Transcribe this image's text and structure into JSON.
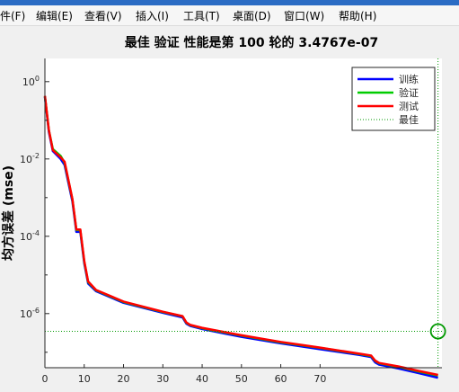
{
  "menubar": {
    "items": [
      {
        "label": "件(F)"
      },
      {
        "label": "编辑(E)"
      },
      {
        "label": "查看(V)"
      },
      {
        "label": "插入(I)"
      },
      {
        "label": "工具(T)"
      },
      {
        "label": "桌面(D)"
      },
      {
        "label": "窗口(W)"
      },
      {
        "label": "帮助(H)"
      }
    ]
  },
  "colors": {
    "train": "#0000ff",
    "validation": "#00cc00",
    "test": "#ff0000",
    "best": "#009900"
  },
  "chart_data": {
    "type": "line",
    "title": "最佳 验证 性能是第 100 轮的 3.4767e-07",
    "ylabel": "均方误差 (mse)",
    "xlabel": "",
    "xlim": [
      0,
      101
    ],
    "ylim_log10": [
      -7.4,
      0.6
    ],
    "y_scale": "log",
    "xticks": [
      0,
      10,
      20,
      30,
      40,
      50,
      60,
      70
    ],
    "xtick_labels": [
      "0",
      "10",
      "20",
      "30",
      "40",
      "50",
      "60",
      "70"
    ],
    "yticks": [
      1e-06,
      0.0001,
      0.01,
      1
    ],
    "ytick_labels": [
      {
        "base": "10",
        "exp": "-6"
      },
      {
        "base": "10",
        "exp": "-4"
      },
      {
        "base": "10",
        "exp": "-2"
      },
      {
        "base": "10",
        "exp": "0"
      }
    ],
    "legend": {
      "position": "top-right",
      "entries": [
        {
          "label": "训练",
          "color": "#0000ff",
          "style": "solid"
        },
        {
          "label": "验证",
          "color": "#00cc00",
          "style": "solid"
        },
        {
          "label": "测试",
          "color": "#ff0000",
          "style": "solid"
        },
        {
          "label": "最佳",
          "color": "#009900",
          "style": "dotted"
        }
      ]
    },
    "series": [
      {
        "name": "训练",
        "color": "#0000ff",
        "x": [
          0,
          1,
          2,
          4,
          5,
          7,
          8,
          9,
          10,
          11,
          13,
          20,
          30,
          35,
          36,
          37,
          40,
          50,
          60,
          70,
          80,
          83,
          84,
          85,
          90,
          95,
          100
        ],
        "y": [
          0.4,
          0.05,
          0.016,
          0.01,
          0.007,
          0.0008,
          0.00013,
          0.00013,
          2e-05,
          6e-06,
          3.8e-06,
          1.9e-06,
          1.05e-06,
          8e-07,
          5.5e-07,
          4.8e-07,
          4e-07,
          2.5e-07,
          1.7e-07,
          1.2e-07,
          8.5e-08,
          7.5e-08,
          5.5e-08,
          4.8e-08,
          3.8e-08,
          2.9e-08,
          2.2e-08
        ]
      },
      {
        "name": "验证",
        "color": "#00cc00",
        "x": [
          0,
          1,
          2,
          4,
          5,
          7,
          8,
          9,
          10,
          11,
          13,
          20,
          30,
          35,
          36,
          37,
          40,
          50,
          60,
          70,
          80,
          83,
          84,
          85,
          90,
          95,
          100
        ],
        "y": [
          0.42,
          0.055,
          0.018,
          0.012,
          0.008,
          0.0009,
          0.000145,
          0.000145,
          2.2e-05,
          6.5e-06,
          4e-06,
          2e-06,
          1.1e-06,
          8.5e-07,
          5.8e-07,
          5e-07,
          4.2e-07,
          2.7e-07,
          1.8e-07,
          1.3e-07,
          9e-08,
          8e-08,
          6e-08,
          5.2e-08,
          4.2e-08,
          3.2e-08,
          2.5e-08
        ]
      },
      {
        "name": "测试",
        "color": "#ff0000",
        "x": [
          0,
          1,
          2,
          4,
          5,
          7,
          8,
          9,
          10,
          11,
          13,
          20,
          30,
          35,
          36,
          37,
          40,
          50,
          60,
          70,
          80,
          83,
          84,
          85,
          90,
          95,
          100
        ],
        "y": [
          0.43,
          0.056,
          0.017,
          0.011,
          0.0085,
          0.00092,
          0.00015,
          0.00015,
          2.3e-05,
          6.8e-06,
          4.1e-06,
          2.05e-06,
          1.12e-06,
          8.6e-07,
          5.9e-07,
          5.1e-07,
          4.3e-07,
          2.75e-07,
          1.85e-07,
          1.32e-07,
          9.2e-08,
          8.2e-08,
          6.1e-08,
          5.3e-08,
          4.3e-08,
          3.3e-08,
          2.6e-08
        ]
      }
    ],
    "best": {
      "epoch": 100,
      "value": 3.4767e-07,
      "marker": "circle",
      "color": "#009900"
    }
  }
}
